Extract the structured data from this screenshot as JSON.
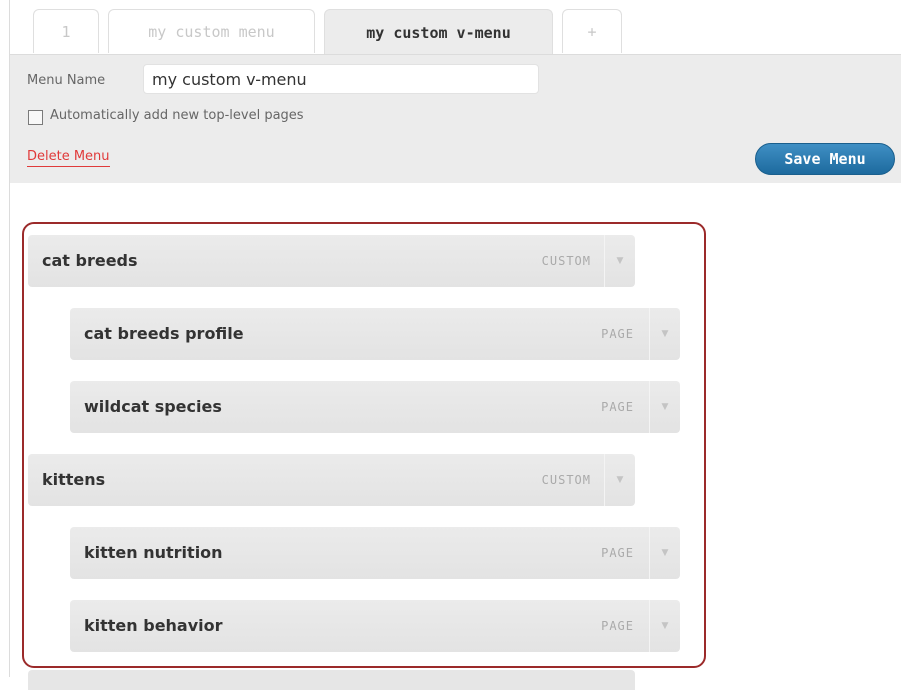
{
  "tabs": [
    {
      "label": "1"
    },
    {
      "label": "my custom menu"
    },
    {
      "label": "my custom v-menu",
      "active": true
    },
    {
      "label": "+"
    }
  ],
  "form": {
    "menu_name_label": "Menu Name",
    "menu_name_value": "my custom v-menu",
    "auto_add_label": "Automatically add new top-level pages",
    "auto_add_checked": false,
    "delete_label": "Delete Menu",
    "save_label": "Save Menu"
  },
  "items": [
    {
      "title": "cat breeds",
      "type": "CUSTOM",
      "depth": 0
    },
    {
      "title": "cat breeds profile",
      "type": "PAGE",
      "depth": 1
    },
    {
      "title": "wildcat species",
      "type": "PAGE",
      "depth": 1
    },
    {
      "title": "kittens",
      "type": "CUSTOM",
      "depth": 0
    },
    {
      "title": "kitten nutrition",
      "type": "PAGE",
      "depth": 1
    },
    {
      "title": "kitten behavior",
      "type": "PAGE",
      "depth": 1
    }
  ],
  "colors": {
    "accent": "#1d6a9e",
    "delete": "#e03a3a",
    "highlight_border": "#9b2a2a"
  }
}
